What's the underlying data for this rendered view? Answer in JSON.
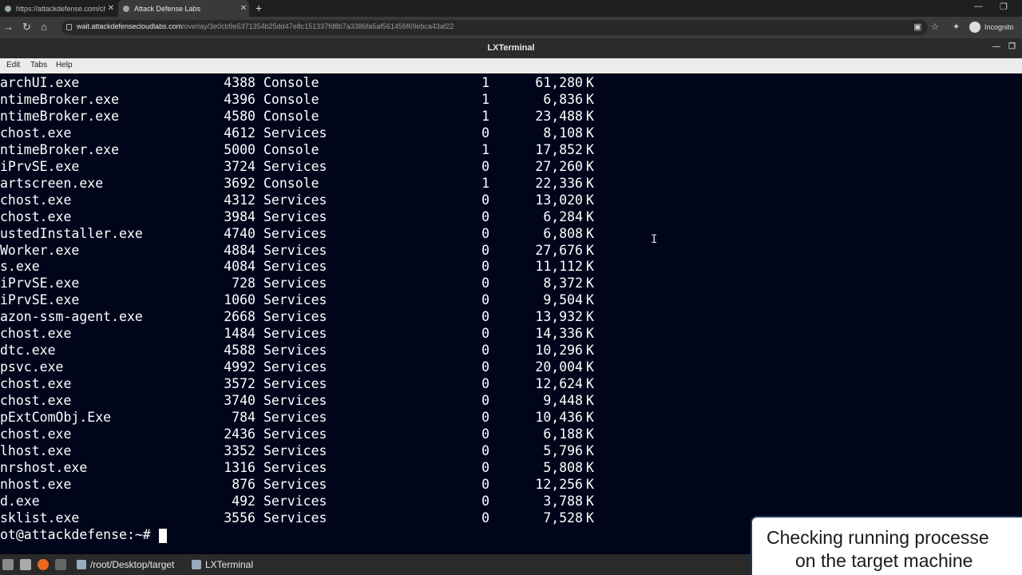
{
  "browser": {
    "tabs": [
      {
        "title": "https://attackdefense.com/challe"
      },
      {
        "title": "Attack Defense Labs"
      }
    ],
    "url_host": "wait.attackdefensecloudlabs.com",
    "url_path": "/overlay/3e0cb9e5371354b25dd47e8c151337fd8b7a3386fa5af561456f69ebca43af22",
    "profile_label": "Incognito"
  },
  "terminal_window": {
    "title": "LXTerminal",
    "menu": [
      "Edit",
      "Tabs",
      "Help"
    ]
  },
  "processes": [
    {
      "name": "archUI.exe",
      "pid": "4388",
      "session": "Console",
      "num": "1",
      "mem": "61,280",
      "unit": "K"
    },
    {
      "name": "ntimeBroker.exe",
      "pid": "4396",
      "session": "Console",
      "num": "1",
      "mem": "6,836",
      "unit": "K"
    },
    {
      "name": "ntimeBroker.exe",
      "pid": "4580",
      "session": "Console",
      "num": "1",
      "mem": "23,488",
      "unit": "K"
    },
    {
      "name": "chost.exe",
      "pid": "4612",
      "session": "Services",
      "num": "0",
      "mem": "8,108",
      "unit": "K"
    },
    {
      "name": "ntimeBroker.exe",
      "pid": "5000",
      "session": "Console",
      "num": "1",
      "mem": "17,852",
      "unit": "K"
    },
    {
      "name": "iPrvSE.exe",
      "pid": "3724",
      "session": "Services",
      "num": "0",
      "mem": "27,260",
      "unit": "K"
    },
    {
      "name": "artscreen.exe",
      "pid": "3692",
      "session": "Console",
      "num": "1",
      "mem": "22,336",
      "unit": "K"
    },
    {
      "name": "chost.exe",
      "pid": "4312",
      "session": "Services",
      "num": "0",
      "mem": "13,020",
      "unit": "K"
    },
    {
      "name": "chost.exe",
      "pid": "3984",
      "session": "Services",
      "num": "0",
      "mem": "6,284",
      "unit": "K"
    },
    {
      "name": "ustedInstaller.exe",
      "pid": "4740",
      "session": "Services",
      "num": "0",
      "mem": "6,808",
      "unit": "K"
    },
    {
      "name": "Worker.exe",
      "pid": "4884",
      "session": "Services",
      "num": "0",
      "mem": "27,676",
      "unit": "K"
    },
    {
      "name": "s.exe",
      "pid": "4084",
      "session": "Services",
      "num": "0",
      "mem": "11,112",
      "unit": "K"
    },
    {
      "name": "iPrvSE.exe",
      "pid": "728",
      "session": "Services",
      "num": "0",
      "mem": "8,372",
      "unit": "K"
    },
    {
      "name": "iPrvSE.exe",
      "pid": "1060",
      "session": "Services",
      "num": "0",
      "mem": "9,504",
      "unit": "K"
    },
    {
      "name": "azon-ssm-agent.exe",
      "pid": "2668",
      "session": "Services",
      "num": "0",
      "mem": "13,932",
      "unit": "K"
    },
    {
      "name": "chost.exe",
      "pid": "1484",
      "session": "Services",
      "num": "0",
      "mem": "14,336",
      "unit": "K"
    },
    {
      "name": "dtc.exe",
      "pid": "4588",
      "session": "Services",
      "num": "0",
      "mem": "10,296",
      "unit": "K"
    },
    {
      "name": "psvc.exe",
      "pid": "4992",
      "session": "Services",
      "num": "0",
      "mem": "20,004",
      "unit": "K"
    },
    {
      "name": "chost.exe",
      "pid": "3572",
      "session": "Services",
      "num": "0",
      "mem": "12,624",
      "unit": "K"
    },
    {
      "name": "chost.exe",
      "pid": "3740",
      "session": "Services",
      "num": "0",
      "mem": "9,448",
      "unit": "K"
    },
    {
      "name": "pExtComObj.Exe",
      "pid": "784",
      "session": "Services",
      "num": "0",
      "mem": "10,436",
      "unit": "K"
    },
    {
      "name": "chost.exe",
      "pid": "2436",
      "session": "Services",
      "num": "0",
      "mem": "6,188",
      "unit": "K"
    },
    {
      "name": "lhost.exe",
      "pid": "3352",
      "session": "Services",
      "num": "0",
      "mem": "5,796",
      "unit": "K"
    },
    {
      "name": "nrshost.exe",
      "pid": "1316",
      "session": "Services",
      "num": "0",
      "mem": "5,808",
      "unit": "K"
    },
    {
      "name": "nhost.exe",
      "pid": "876",
      "session": "Services",
      "num": "0",
      "mem": "12,256",
      "unit": "K"
    },
    {
      "name": "d.exe",
      "pid": "492",
      "session": "Services",
      "num": "0",
      "mem": "3,788",
      "unit": "K"
    },
    {
      "name": "sklist.exe",
      "pid": "3556",
      "session": "Services",
      "num": "0",
      "mem": "7,528",
      "unit": "K"
    }
  ],
  "prompt": "ot@attackdefense:~# ",
  "taskbar": {
    "items": [
      {
        "label": "/root/Desktop/target"
      },
      {
        "label": "LXTerminal"
      }
    ]
  },
  "caption": {
    "line1": "Checking running processe",
    "line2": "on the target machine"
  }
}
